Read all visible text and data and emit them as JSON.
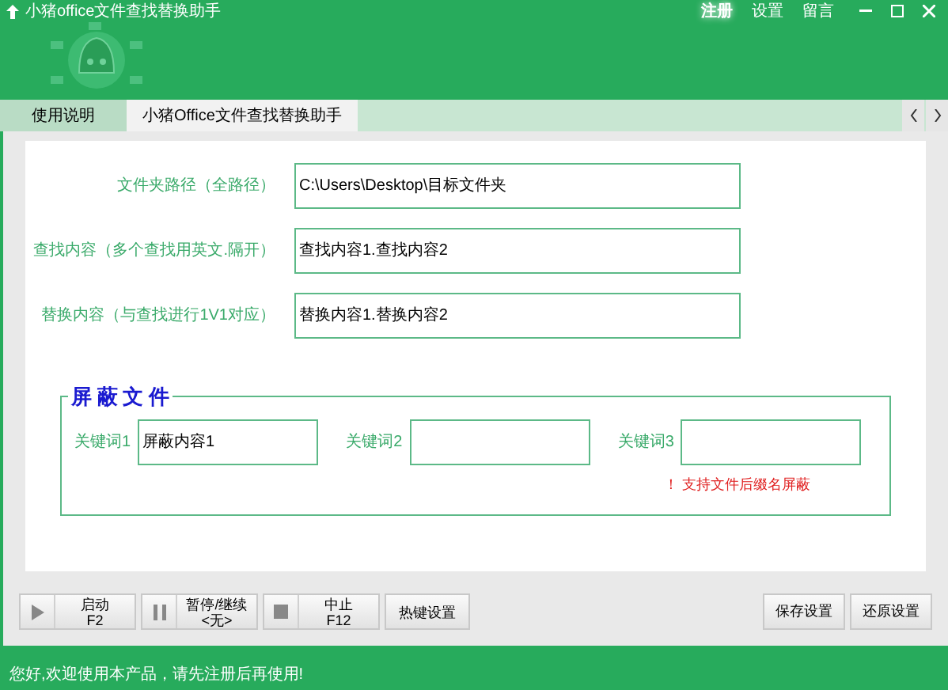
{
  "window": {
    "title": "小猪office文件查找替换助手",
    "links": [
      {
        "label": "注册",
        "selected": true
      },
      {
        "label": "设置",
        "selected": false
      },
      {
        "label": "留言",
        "selected": false
      }
    ]
  },
  "tabs": [
    {
      "label": "使用说明",
      "selected": false
    },
    {
      "label": "小猪Office文件查找替换助手",
      "selected": true
    }
  ],
  "fields": [
    {
      "label": "文件夹路径（全路径）",
      "value": "C:\\Users\\Desktop\\目标文件夹"
    },
    {
      "label": "查找内容（多个查找用英文.隔开）",
      "value": "查找内容1.查找内容2"
    },
    {
      "label": "替换内容（与查找进行1V1对应）",
      "value": "替换内容1.替换内容2"
    }
  ],
  "shield": {
    "title": "屏 蔽 文 件",
    "keywords": [
      {
        "label": "关键词1",
        "value": "屏蔽内容1"
      },
      {
        "label": "关键词2"
      },
      {
        "label": "关键词3"
      }
    ],
    "note": "！ 支持文件后缀名屏蔽"
  },
  "toolbar": [
    {
      "kind": "play",
      "label": "启动",
      "key": "F2"
    },
    {
      "kind": "pause",
      "label": "暂停/继续",
      "key": "<无>"
    },
    {
      "kind": "stop",
      "label": "中止",
      "key": "F12"
    },
    {
      "kind": "plain",
      "label": "热键设置"
    }
  ],
  "right_buttons": [
    "保存设置",
    "还原设置"
  ],
  "status_bar": "您好,欢迎使用本产品，请先注册后再使用!"
}
